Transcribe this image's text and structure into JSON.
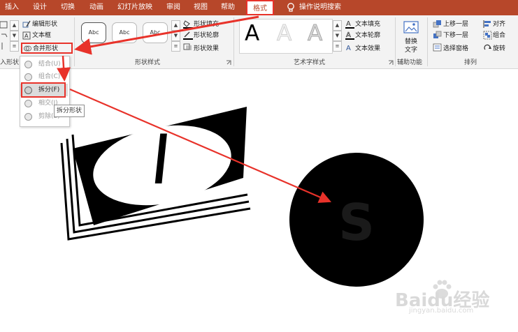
{
  "tabs": [
    "插入",
    "设计",
    "切换",
    "动画",
    "幻灯片放映",
    "审阅",
    "视图",
    "帮助",
    "格式"
  ],
  "tell_me": "操作说明搜索",
  "insert_shapes": {
    "edit_shape": "编辑形状",
    "text_box": "文本框",
    "merge_shapes": "合并形状",
    "group_label_partial": "入形状"
  },
  "shape_styles": {
    "style_samples": [
      "Abc",
      "Abc",
      "Abc"
    ],
    "fill": "形状填充",
    "outline": "形状轮廓",
    "effects": "形状效果",
    "group_label": "形状样式"
  },
  "wordart": {
    "samples": [
      "A",
      "A",
      "A"
    ],
    "text_fill": "文本填充",
    "text_outline": "文本轮廓",
    "text_effects": "文本效果",
    "group_label": "艺术字样式"
  },
  "accessibility": {
    "alt_text_line1": "替换",
    "alt_text_line2": "文字",
    "group_label": "辅助功能"
  },
  "arrange": {
    "bring_forward": "上移一层",
    "send_backward": "下移一层",
    "selection_pane": "选择窗格",
    "align": "对齐",
    "group": "组合",
    "rotate": "旋转",
    "group_label": "排列"
  },
  "merge_menu": {
    "items": [
      {
        "label": "结合(U)",
        "enabled": false
      },
      {
        "label": "组合(C)",
        "enabled": false
      },
      {
        "label": "拆分(F)",
        "enabled": true
      },
      {
        "label": "相交(I)",
        "enabled": false
      },
      {
        "label": "剪除(S)",
        "enabled": false
      }
    ],
    "tooltip": "拆分形状"
  },
  "canvas": {
    "card_text": "I",
    "circle_text": "S"
  },
  "watermark": {
    "brand": "Baidu经验",
    "url": "jingyan.baidu.com"
  },
  "colors": {
    "ribbon_accent": "#b7472a",
    "highlight_red": "#e8322a"
  }
}
